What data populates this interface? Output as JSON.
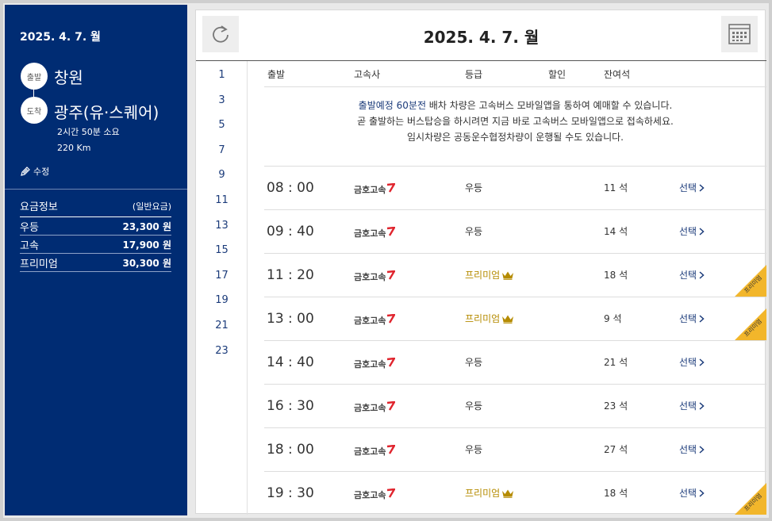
{
  "sidebar": {
    "date": "2025. 4. 7. 월",
    "departure_badge": "출발",
    "departure_city": "창원",
    "arrival_badge": "도착",
    "arrival_city": "광주(유·스퀘어)",
    "duration": "2시간 50분 소요",
    "distance": "220 Km",
    "edit_label": "수정",
    "fare_title": "요금정보",
    "fare_sub": "(일반요금)",
    "fares": [
      {
        "grade": "우등",
        "amount": "23,300 원"
      },
      {
        "grade": "고속",
        "amount": "17,900 원"
      },
      {
        "grade": "프리미엄",
        "amount": "30,300 원"
      }
    ]
  },
  "header": {
    "title": "2025. 4. 7. 월"
  },
  "hours": [
    "1",
    "3",
    "5",
    "7",
    "9",
    "11",
    "13",
    "15",
    "17",
    "19",
    "21",
    "23"
  ],
  "columns": {
    "departure": "출발",
    "company": "고속사",
    "grade": "등급",
    "discount": "할인",
    "seats": "잔여석"
  },
  "notice": {
    "line1_highlight": "출발예정 60분전",
    "line1_rest": " 배차 차량은 고속버스 모바일앱을 통하여 예매할 수 있습니다.",
    "line2": "곧 출발하는 버스탑승을 하시려면 지금 바로 고속버스 모바일앱으로 접속하세요.",
    "line3": "임시차량은 공동운수협정차량이 운행될 수도 있습니다."
  },
  "ribbon_text": "프리미엄",
  "select_label": "선택",
  "colors": {
    "navy": "#002c73",
    "premium": "#b58b00",
    "ribbon": "#f2b62b",
    "logo_red": "#e0252e"
  },
  "schedule": [
    {
      "time": "08 : 00",
      "company": "금호고속",
      "grade": "우등",
      "premium": false,
      "seats": "11 석"
    },
    {
      "time": "09 : 40",
      "company": "금호고속",
      "grade": "우등",
      "premium": false,
      "seats": "14 석"
    },
    {
      "time": "11 : 20",
      "company": "금호고속",
      "grade": "프리미엄",
      "premium": true,
      "seats": "18 석"
    },
    {
      "time": "13 : 00",
      "company": "금호고속",
      "grade": "프리미엄",
      "premium": true,
      "seats": "9 석"
    },
    {
      "time": "14 : 40",
      "company": "금호고속",
      "grade": "우등",
      "premium": false,
      "seats": "21 석"
    },
    {
      "time": "16 : 30",
      "company": "금호고속",
      "grade": "우등",
      "premium": false,
      "seats": "23 석"
    },
    {
      "time": "18 : 00",
      "company": "금호고속",
      "grade": "우등",
      "premium": false,
      "seats": "27 석"
    },
    {
      "time": "19 : 30",
      "company": "금호고속",
      "grade": "프리미엄",
      "premium": true,
      "seats": "18 석"
    }
  ]
}
